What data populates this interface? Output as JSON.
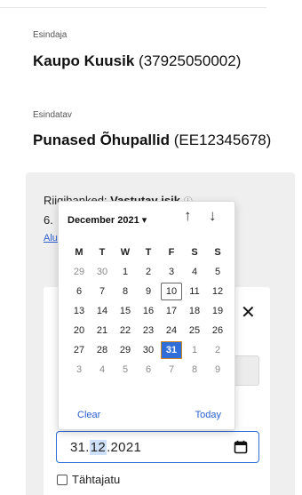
{
  "representative": {
    "label": "Esindaja",
    "name": "Kaupo Kuusik",
    "code": "(37925050002)"
  },
  "represented": {
    "label": "Esindatav",
    "name": "Punased Õhupallid",
    "code": "(EE12345678)"
  },
  "panel": {
    "role_prefix": "Riigihanked:",
    "role_value": "Vastutav isik",
    "line2_prefix": "6.",
    "link_text": "Alu"
  },
  "date_field": {
    "day": "31.",
    "month": "12",
    "year": ".2021"
  },
  "checkbox": {
    "label": "Tähtajatu",
    "checked": false
  },
  "picker": {
    "month_label": "December 2021 ▾",
    "weekdays": [
      "M",
      "T",
      "W",
      "T",
      "F",
      "S",
      "S"
    ],
    "weeks": [
      [
        "29",
        "30",
        "1",
        "2",
        "3",
        "4",
        "5"
      ],
      [
        "6",
        "7",
        "8",
        "9",
        "10",
        "11",
        "12"
      ],
      [
        "13",
        "14",
        "15",
        "16",
        "17",
        "18",
        "19"
      ],
      [
        "20",
        "21",
        "22",
        "23",
        "24",
        "25",
        "26"
      ],
      [
        "27",
        "28",
        "29",
        "30",
        "31",
        "1",
        "2"
      ],
      [
        "3",
        "4",
        "5",
        "6",
        "7",
        "8",
        "9"
      ]
    ],
    "other_month_cells": [
      [
        0,
        0
      ],
      [
        0,
        1
      ],
      [
        4,
        5
      ],
      [
        4,
        6
      ],
      [
        5,
        0
      ],
      [
        5,
        1
      ],
      [
        5,
        2
      ],
      [
        5,
        3
      ],
      [
        5,
        4
      ],
      [
        5,
        5
      ],
      [
        5,
        6
      ]
    ],
    "today_cell": [
      1,
      4
    ],
    "selected_cell": [
      4,
      4
    ],
    "clear_label": "Clear",
    "today_label": "Today"
  },
  "colors": {
    "accent": "#2f6dd8",
    "selected_border": "#d0871f",
    "link": "#2b5fd0"
  }
}
